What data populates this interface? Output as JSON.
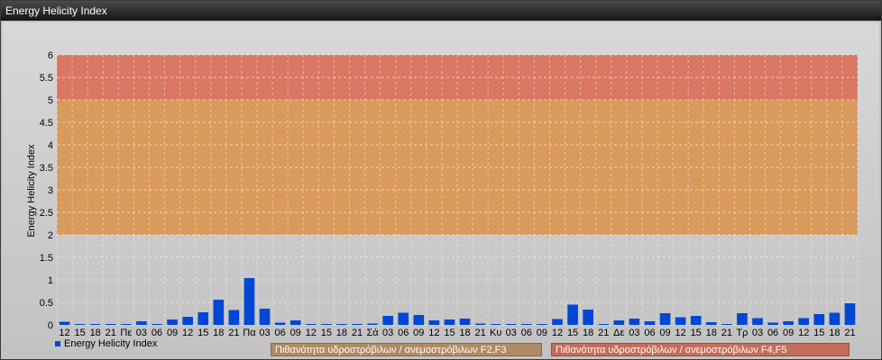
{
  "window": {
    "title": "Energy Helicity Index"
  },
  "legend": {
    "series_label": "Energy Helicity Index",
    "band_f2f3_label": "Πιθανότητα υδροστρόβιλων / ανεμοστρόβιλων F2,F3",
    "band_f4f5_label": "Πιθανότητα υδροστρόβιλων / ανεμοστρόβιλων F4,F5"
  },
  "colors": {
    "bar": "#0047d6",
    "band_f2f3": "#d8995a",
    "band_f4f5": "#d97560",
    "box_f2f3": "#b08a63",
    "box_f4f5": "#c56c5a"
  },
  "chart_data": {
    "type": "bar",
    "title": "",
    "xlabel": "",
    "ylabel": "Energy Helicity Index",
    "ylim": [
      0,
      6
    ],
    "yticks": [
      "0",
      "0.5",
      "1",
      "1.5",
      "2",
      "2.5",
      "3",
      "3.5",
      "4",
      "4.5",
      "5",
      "5.5",
      "6"
    ],
    "grid": true,
    "legend_position": "bottom-left",
    "bands": [
      {
        "name": "Πιθανότητα υδροστρόβιλων / ανεμοστρόβιλων F2,F3",
        "from": 2,
        "to": 5
      },
      {
        "name": "Πιθανότητα υδροστρόβιλων / ανεμοστρόβιλων F4,F5",
        "from": 5,
        "to": 6
      }
    ],
    "categories": [
      "12",
      "15",
      "18",
      "21",
      "Πε",
      "03",
      "06",
      "09",
      "12",
      "15",
      "18",
      "21",
      "Πα",
      "03",
      "06",
      "09",
      "12",
      "15",
      "18",
      "21",
      "Σά",
      "03",
      "06",
      "09",
      "12",
      "15",
      "18",
      "21",
      "Κυ",
      "03",
      "06",
      "09",
      "12",
      "15",
      "18",
      "21",
      "Δε",
      "03",
      "06",
      "09",
      "12",
      "15",
      "18",
      "21",
      "Τρ",
      "03",
      "06",
      "09",
      "12",
      "15",
      "18",
      "21"
    ],
    "series": [
      {
        "name": "Energy Helicity Index",
        "values": [
          0.07,
          0.02,
          0.02,
          0.02,
          0.02,
          0.08,
          0.02,
          0.12,
          0.18,
          0.28,
          0.56,
          0.33,
          1.04,
          0.36,
          0.05,
          0.1,
          0.02,
          0.02,
          0.02,
          0.02,
          0.03,
          0.2,
          0.27,
          0.22,
          0.1,
          0.12,
          0.14,
          0.03,
          0.02,
          0.02,
          0.02,
          0.02,
          0.13,
          0.45,
          0.34,
          0.02,
          0.1,
          0.14,
          0.08,
          0.26,
          0.17,
          0.2,
          0.06,
          0.02,
          0.26,
          0.15,
          0.05,
          0.08,
          0.15,
          0.24,
          0.27,
          0.48
        ]
      }
    ]
  }
}
